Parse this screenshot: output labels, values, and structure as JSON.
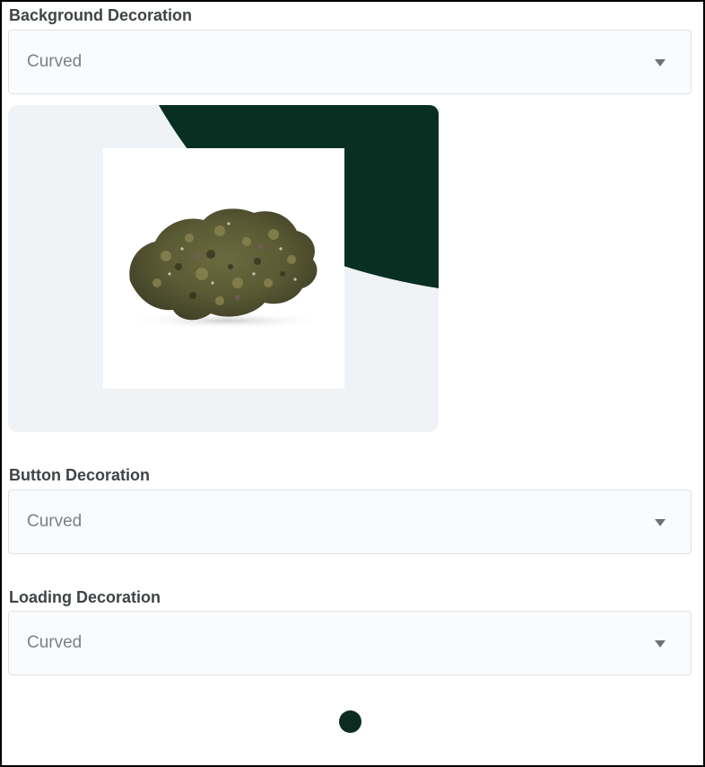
{
  "background_decoration": {
    "label": "Background Decoration",
    "selected": "Curved"
  },
  "preview": {
    "accent_color": "#082f22",
    "background_color": "#f0f3f5",
    "image_icon": "cannabis-flower"
  },
  "button_decoration": {
    "label": "Button Decoration",
    "selected": "Curved"
  },
  "loading_decoration": {
    "label": "Loading Decoration",
    "selected": "Curved"
  },
  "loader": {
    "color": "#0c2c22"
  }
}
